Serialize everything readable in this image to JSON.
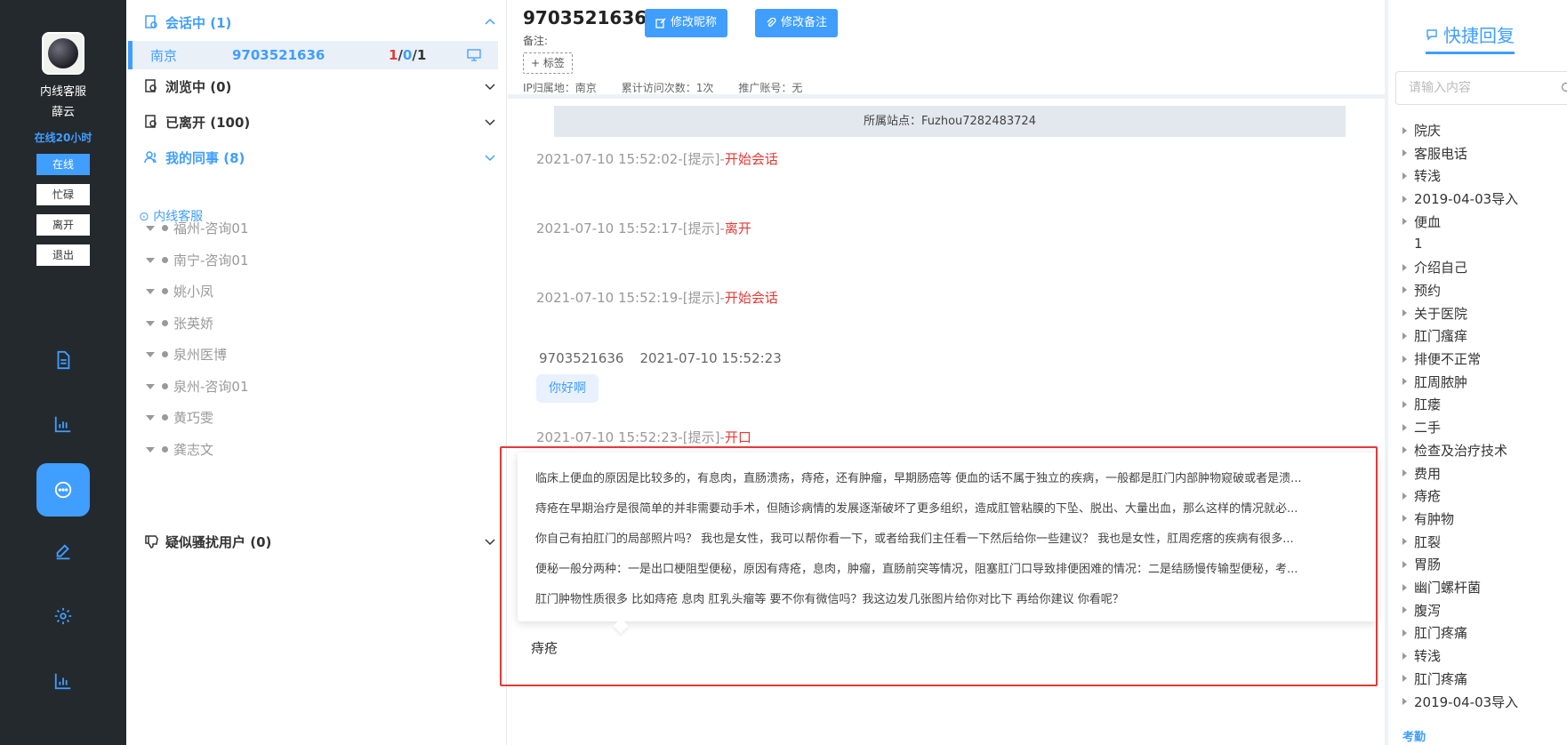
{
  "rail": {
    "role": "内线客服",
    "name": "薛云",
    "online_time": "在线20小时",
    "statuses": [
      "在线",
      "忙碌",
      "离开",
      "退出"
    ],
    "icons": [
      "document-icon",
      "chart-icon",
      "chat-icon",
      "edit-icon",
      "settings-icon",
      "stats-icon"
    ]
  },
  "list": {
    "in_session": "会话中 (1)",
    "session": {
      "city": "南京",
      "id": "9703521636",
      "count_red": "1",
      "count_blue": "0",
      "count_total": "1"
    },
    "browsing": "浏览中 (0)",
    "left": "已离开 (100)",
    "colleagues": "我的同事 (8)",
    "sub_group": "内线客服",
    "colleague_list": [
      "福州-咨询01",
      "南宁-咨询01",
      "姚小凤",
      "张英娇",
      "泉州医博",
      "泉州-咨询01",
      "黄巧雯",
      "龚志文"
    ],
    "harass": "疑似骚扰用户 (0)"
  },
  "header": {
    "visitor_id": "9703521636",
    "edit_nickname": "修改昵称",
    "edit_note": "修改备注",
    "note_label": "备注:",
    "tag_button": "+ 标签",
    "ip_location": "IP归属地：南京",
    "visit_count": "累计访问次数：1次",
    "promo_account": "推广账号：无"
  },
  "chat": {
    "site": "所属站点：Fuzhou7282483724",
    "events": [
      {
        "time": "2021-07-10 15:52:02-[提示]-",
        "event": "开始会话"
      },
      {
        "time": "2021-07-10 15:52:17-[提示]-",
        "event": "离开"
      },
      {
        "time": "2021-07-10 15:52:19-[提示]-",
        "event": "开始会话"
      }
    ],
    "visitor_msg": {
      "sender": "9703521636",
      "time": "2021-07-10 15:52:23",
      "text": "你好啊"
    },
    "last_event": {
      "time": "2021-07-10 15:52:23-[提示]-",
      "event": "开口"
    }
  },
  "suggestions": [
    "临床上便血的原因是比较多的，有息肉，直肠溃疡，痔疮，还有肿瘤，早期肠癌等 便血的话不属于独立的疾病，一般都是肛门内部肿物窥破或者是溃...",
    "痔疮在早期治疗是很简单的并非需要动手术，但随诊病情的发展逐渐破坏了更多组织，造成肛管粘膜的下坠、脱出、大量出血，那么这样的情况就必...",
    "你自己有拍肛门的局部照片吗？ 我也是女性，我可以帮你看一下，或者给我们主任看一下然后给你一些建议？ 我也是女性，肛周疙瘩的疾病有很多...",
    "便秘一般分两种：一是出口梗阻型便秘，原因有痔疮，息肉，肿瘤，直肠前突等情况，阻塞肛门口导致排便困难的情况：二是结肠慢传输型便秘，考...",
    "肛门肿物性质很多 比如痔疮 息肉 肛乳头瘤等 要不你有微信吗？我这边发几张图片给你对比下 再给你建议 你看呢？"
  ],
  "input": {
    "text": "痔疮"
  },
  "quick_reply": {
    "title": "快捷回复",
    "search_placeholder": "请输入内容",
    "items": [
      {
        "label": "院庆",
        "arrow": true
      },
      {
        "label": "客服电话",
        "arrow": true
      },
      {
        "label": "转浅",
        "arrow": true
      },
      {
        "label": "2019-04-03导入",
        "arrow": true
      },
      {
        "label": "便血",
        "arrow": true
      },
      {
        "label": "1",
        "arrow": false
      },
      {
        "label": "介绍自己",
        "arrow": true
      },
      {
        "label": "预约",
        "arrow": true
      },
      {
        "label": "关于医院",
        "arrow": true
      },
      {
        "label": "肛门瘙痒",
        "arrow": true
      },
      {
        "label": "排便不正常",
        "arrow": true
      },
      {
        "label": "肛周脓肿",
        "arrow": true
      },
      {
        "label": "肛瘘",
        "arrow": true
      },
      {
        "label": "二手",
        "arrow": true
      },
      {
        "label": "检查及治疗技术",
        "arrow": true
      },
      {
        "label": "费用",
        "arrow": true
      },
      {
        "label": "痔疮",
        "arrow": true
      },
      {
        "label": "有肿物",
        "arrow": true
      },
      {
        "label": "肛裂",
        "arrow": true
      },
      {
        "label": "胃肠",
        "arrow": true
      },
      {
        "label": "幽门螺杆菌",
        "arrow": true
      },
      {
        "label": "腹泻",
        "arrow": true
      },
      {
        "label": "肛门疼痛",
        "arrow": true
      },
      {
        "label": "转浅",
        "arrow": true
      },
      {
        "label": "肛门疼痛",
        "arrow": true
      },
      {
        "label": "2019-04-03导入",
        "arrow": true
      }
    ],
    "bottom": "考勤"
  },
  "colors": {
    "accent": "#409eff",
    "rail_bg": "#24292e",
    "alert": "#e53935"
  }
}
